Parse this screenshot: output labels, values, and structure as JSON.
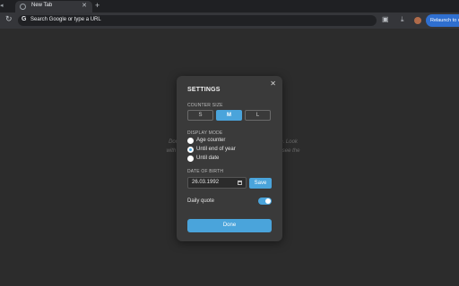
{
  "browser": {
    "tab_title": "New Tab",
    "tab_close": "✕",
    "new_tab": "+",
    "omnibox_text": "Search Google or type a URL",
    "relaunch_label": "Relaunch to u"
  },
  "page": {
    "quote_line1": "Don't believe ev                                  s limitation. Look",
    "quote_line2": "with your unders                                   and you'll see the"
  },
  "settings": {
    "title": "SETTINGS",
    "close": "✕",
    "counter_size_label": "COUNTER SIZE",
    "sizes": [
      "S",
      "M",
      "L"
    ],
    "selected_size": "M",
    "display_mode_label": "DISPLAY MODE",
    "modes": [
      "Age counter",
      "Until end of year",
      "Until date"
    ],
    "selected_mode": "Until end of year",
    "dob_label": "DATE OF BIRTH",
    "dob_value": "26.03.1992",
    "save_label": "Save",
    "daily_quote_label": "Daily quote",
    "daily_quote_on": true,
    "done_label": "Done"
  },
  "colors": {
    "accent": "#4aa4db",
    "modal_bg": "#3a3a3a",
    "page_bg": "#2c2c2c"
  }
}
